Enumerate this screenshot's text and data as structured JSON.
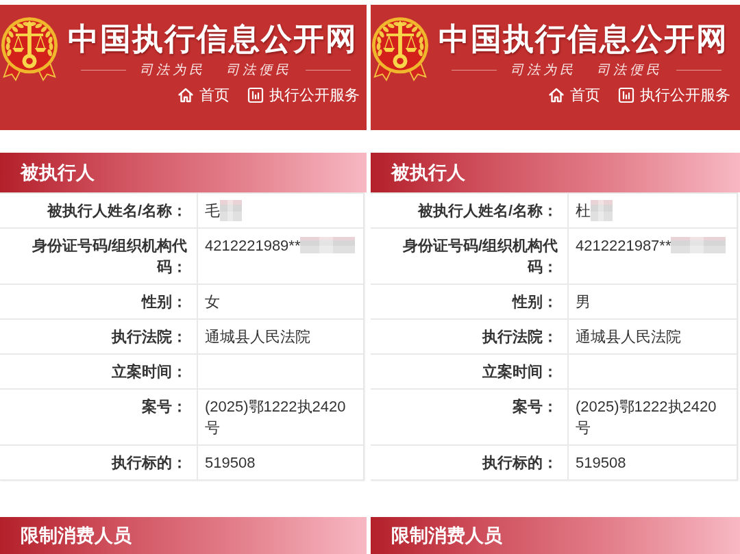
{
  "panels": [
    {
      "header": {
        "title": "中国执行信息公开网",
        "slogans": [
          "司法为民",
          "司法便民"
        ],
        "nav": [
          "首页",
          "执行公开服务"
        ]
      },
      "sections": [
        {
          "title": "被执行人",
          "rows": [
            {
              "label": "被执行人姓名/名称：",
              "value": "毛",
              "redacted": true
            },
            {
              "label": "身份证号码/组织机构代码：",
              "value": "4212221989**",
              "redacted": true
            },
            {
              "label": "性别：",
              "value": "女",
              "redacted": false
            },
            {
              "label": "执行法院：",
              "value": "通城县人民法院",
              "redacted": false
            },
            {
              "label": "立案时间：",
              "redacted": false
            },
            {
              "label": "案号：",
              "value": "(2025)鄂1222执2420号",
              "redacted": false
            },
            {
              "label": "执行标的：",
              "value": "519508",
              "redacted": false
            }
          ]
        },
        {
          "title": "限制消费人员"
        }
      ]
    },
    {
      "header": {
        "title": "中国执行信息公开网",
        "slogans": [
          "司法为民",
          "司法便民"
        ],
        "nav": [
          "首页",
          "执行公开服务"
        ]
      },
      "sections": [
        {
          "title": "被执行人",
          "rows": [
            {
              "label": "被执行人姓名/名称：",
              "value": "杜",
              "redacted": true
            },
            {
              "label": "身份证号码/组织机构代码：",
              "value": "4212221987**",
              "redacted": true
            },
            {
              "label": "性别：",
              "value": "男",
              "redacted": false
            },
            {
              "label": "执行法院：",
              "value": "通城县人民法院",
              "redacted": false
            },
            {
              "label": "立案时间：",
              "redacted": false
            },
            {
              "label": "案号：",
              "value": "(2025)鄂1222执2420号",
              "redacted": false
            },
            {
              "label": "执行标的：",
              "value": "519508",
              "redacted": false
            }
          ]
        },
        {
          "title": "限制消费人员"
        }
      ]
    }
  ]
}
